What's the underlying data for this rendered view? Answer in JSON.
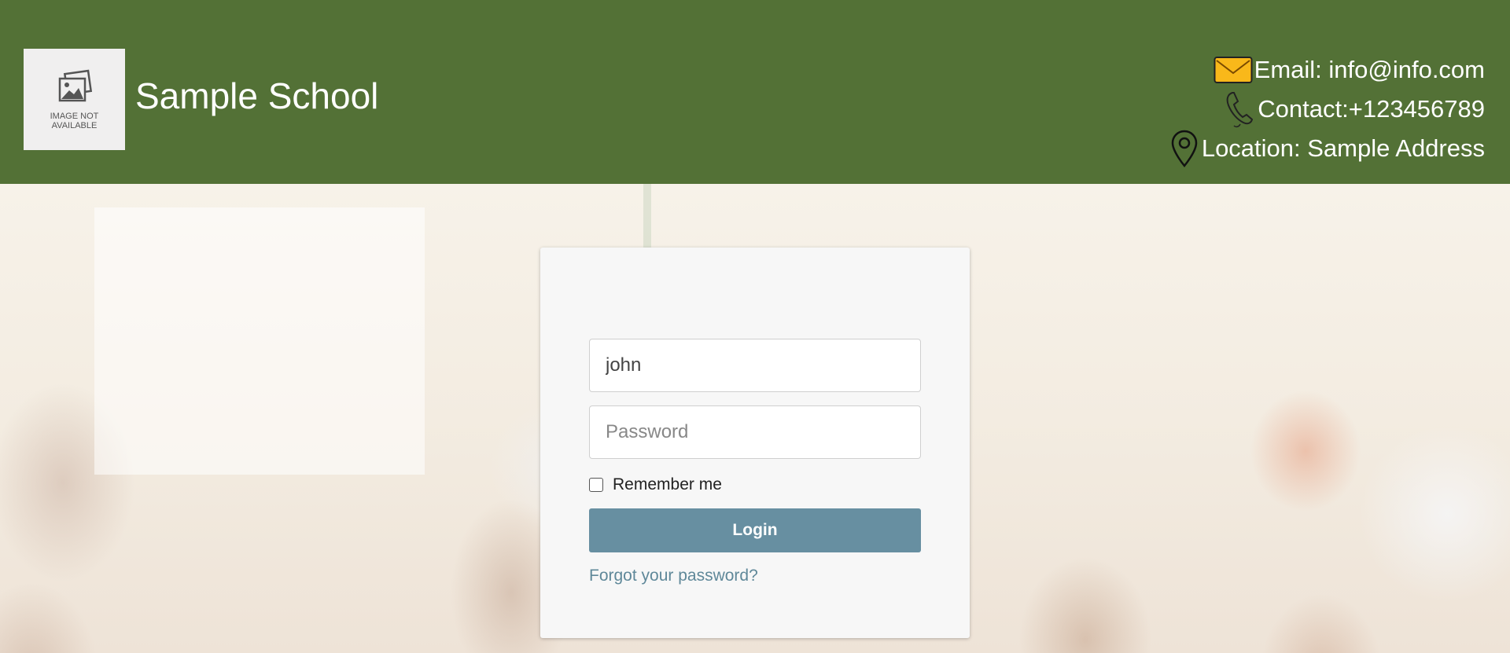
{
  "header": {
    "logo_caption": "IMAGE NOT AVAILABLE",
    "school_name": "Sample School",
    "email": "Email: info@info.com",
    "contact": "Contact:+123456789",
    "location": "Location: Sample Address"
  },
  "login": {
    "username_value": "john",
    "password_placeholder": "Password",
    "remember_label": "Remember me",
    "login_label": "Login",
    "forgot_label": "Forgot your password?"
  },
  "icons": {
    "logo": "image-placeholder-icon",
    "email": "envelope-icon",
    "contact": "phone-icon",
    "location": "map-pin-icon"
  },
  "colors": {
    "header_bg": "#537136",
    "button_bg": "#678fa1",
    "link": "#5f8899"
  }
}
